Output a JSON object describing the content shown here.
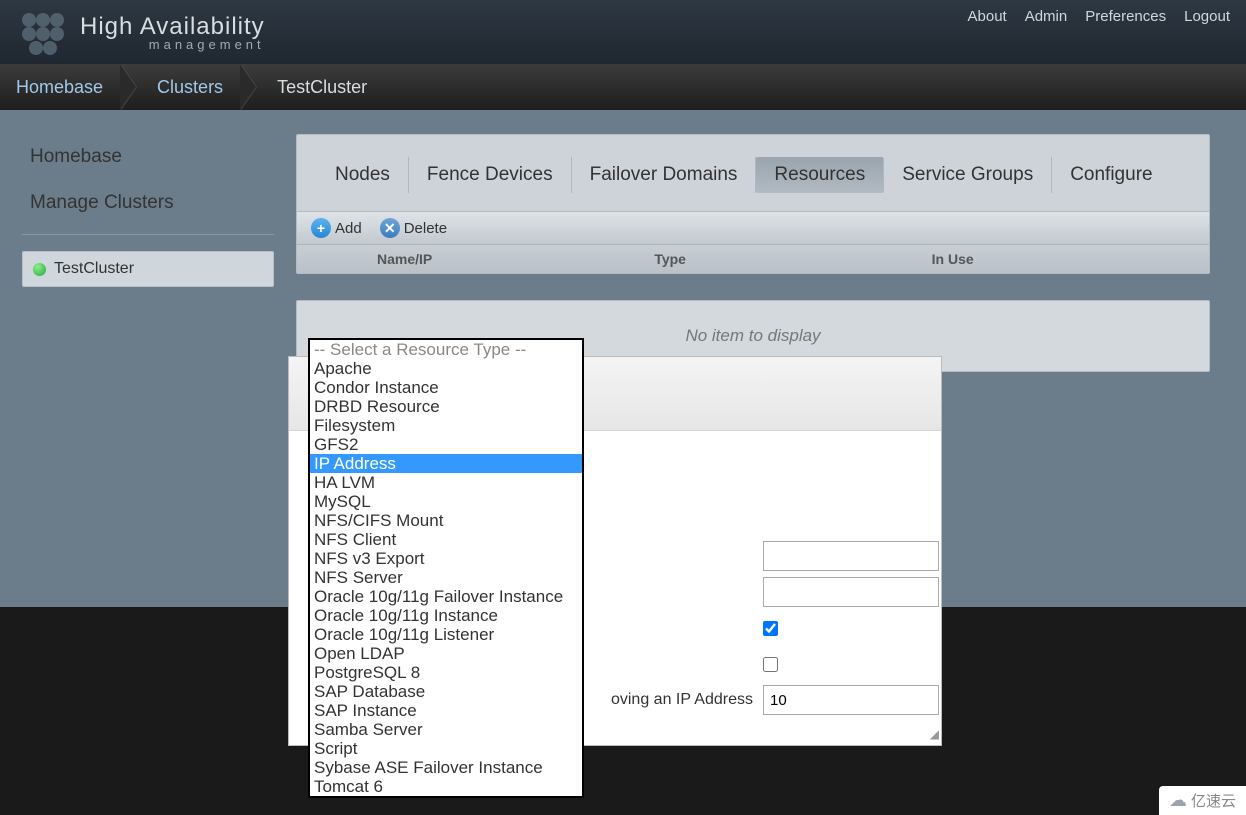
{
  "brand": {
    "title": "High Availability",
    "subtitle": "management"
  },
  "top_nav": [
    "About",
    "Admin",
    "Preferences",
    "Logout"
  ],
  "breadcrumb": [
    "Homebase",
    "Clusters",
    "TestCluster"
  ],
  "sidebar": {
    "links": [
      "Homebase",
      "Manage Clusters"
    ],
    "cluster_name": "TestCluster"
  },
  "tabs": [
    "Nodes",
    "Fence Devices",
    "Failover Domains",
    "Resources",
    "Service Groups",
    "Configure"
  ],
  "active_tab_index": 3,
  "toolbar": {
    "add": "Add",
    "delete": "Delete"
  },
  "table_columns": [
    "",
    "Name/IP",
    "Type",
    "In Use"
  ],
  "empty_message": "No item to display",
  "resource_types": {
    "placeholder": "-- Select a Resource Type --",
    "options": [
      "Apache",
      "Condor Instance",
      "DRBD Resource",
      "Filesystem",
      "GFS2",
      "IP Address",
      "HA LVM",
      "MySQL",
      "NFS/CIFS Mount",
      "NFS Client",
      "NFS v3 Export",
      "NFS Server",
      "Oracle 10g/11g Failover Instance",
      "Oracle 10g/11g Instance",
      "Oracle 10g/11g Listener",
      "Open LDAP",
      "PostgreSQL 8",
      "SAP Database",
      "SAP Instance",
      "Samba Server",
      "Script",
      "Sybase ASE Failover Instance",
      "Tomcat 6"
    ],
    "selected": "IP Address"
  },
  "modal_form": {
    "visible_label": "oving an IP Address",
    "sleeptime_value": "10",
    "checkbox1_checked": true,
    "checkbox2_checked": false
  },
  "watermark": "亿速云"
}
